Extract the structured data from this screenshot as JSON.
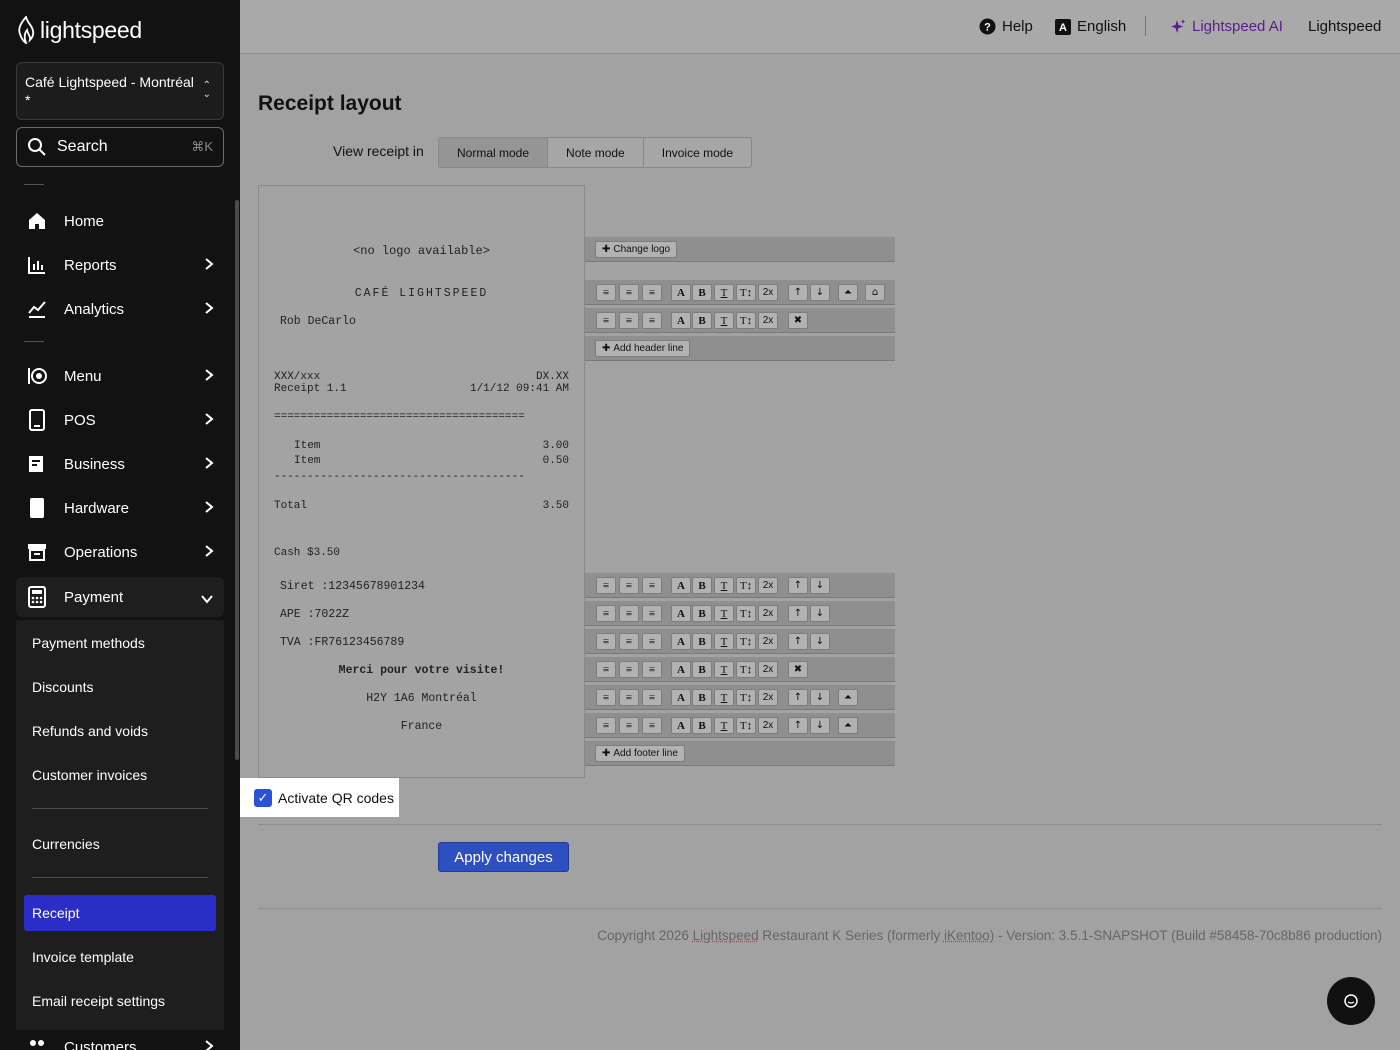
{
  "app": {
    "brand": "lightspeed"
  },
  "sidebar": {
    "store_name": "Café Lightspeed - Montréal",
    "store_sub": "*",
    "search": {
      "label": "Search",
      "shortcut": "⌘K"
    },
    "nav": [
      {
        "label": "Home",
        "icon": "home-icon"
      },
      {
        "label": "Reports",
        "icon": "reports-icon"
      },
      {
        "label": "Analytics",
        "icon": "analytics-icon"
      },
      {
        "label": "Menu",
        "icon": "menu-icon"
      },
      {
        "label": "POS",
        "icon": "pos-icon"
      },
      {
        "label": "Business",
        "icon": "business-icon"
      },
      {
        "label": "Hardware",
        "icon": "hardware-icon"
      },
      {
        "label": "Operations",
        "icon": "operations-icon"
      },
      {
        "label": "Payment",
        "icon": "payment-icon"
      }
    ],
    "payment_items": [
      "Payment methods",
      "Discounts",
      "Refunds and voids",
      "Customer invoices",
      "Currencies",
      "Receipt",
      "Invoice template",
      "Email receipt settings"
    ],
    "partial_item": "Customers",
    "active_item": "Receipt",
    "active_color": "#2a2dc6"
  },
  "topbar": {
    "help": "Help",
    "language": "English",
    "ai": "Lightspeed AI",
    "account": "Lightspeed",
    "ai_color": "#5a1e8c"
  },
  "page": {
    "title": "Receipt layout",
    "view_label": "View receipt in",
    "modes": [
      "Normal mode",
      "Note mode",
      "Invoice mode"
    ],
    "selected_mode": "Normal mode"
  },
  "receipt": {
    "logo": "<no logo available>",
    "name": "CAFÉ LIGHTSPEED",
    "server": "Rob DeCarlo",
    "ref_left": "XXX/xxx",
    "ref_right": "DX.XX",
    "receipt_no": "Receipt 1.1",
    "datetime": "1/1/12 09:41 AM",
    "double_line": "======================================",
    "items": [
      {
        "name": "Item",
        "price": "3.00"
      },
      {
        "name": "Item",
        "price": "0.50"
      }
    ],
    "single_line": "--------------------------------------",
    "total_label": "Total",
    "total_value": "3.50",
    "payment": "Cash $3.50",
    "siret": "Siret :12345678901234",
    "ape": "APE :7022Z",
    "tva": "TVA :FR76123456789",
    "thanks": "Merci pour votre visite!",
    "city": "H2Y 1A6 Montréal",
    "country": "France"
  },
  "controls": {
    "change_logo": "Change logo",
    "add_header": "Add header line",
    "add_footer": "Add footer line",
    "size_label": "2x"
  },
  "qr": {
    "label": "Activate QR codes",
    "checked": true
  },
  "apply_label": "Apply changes",
  "footer": {
    "c1": "Copyright 2026 ",
    "c2": "Lightspeed",
    "c3": " Restaurant K Series (formerly ",
    "c4": "iKentoo",
    "c5": ") - Version: 3.5.1-SNAPSHOT (Build #58458-70c8b86 production)"
  }
}
